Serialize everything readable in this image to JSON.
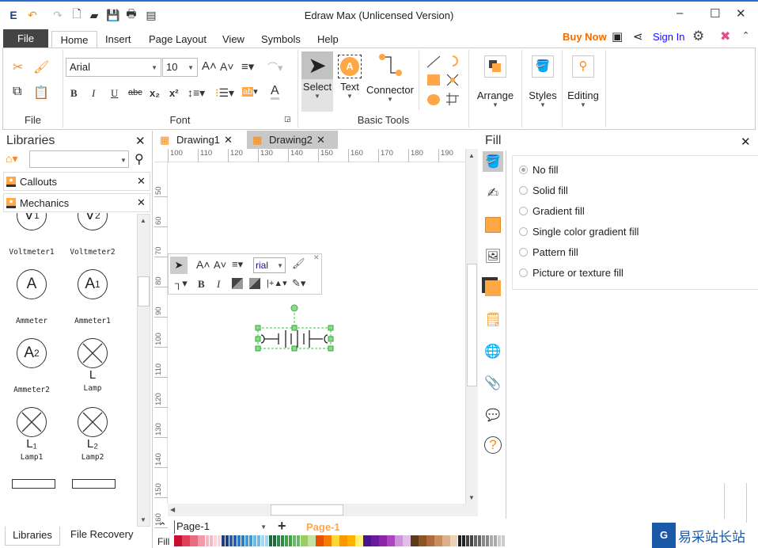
{
  "app": {
    "title": "Edraw Max (Unlicensed Version)"
  },
  "menu": {
    "file": "File",
    "tabs": [
      "Home",
      "Insert",
      "Page Layout",
      "View",
      "Symbols",
      "Help"
    ],
    "buy_now": "Buy Now",
    "sign_in": "Sign In"
  },
  "ribbon": {
    "font_name": "Arial",
    "font_size": "10",
    "groups": {
      "file": "File",
      "font": "Font",
      "basic_tools": "Basic Tools"
    },
    "select": "Select",
    "text": "Text",
    "connector": "Connector",
    "arrange": "Arrange",
    "styles": "Styles",
    "editing": "Editing"
  },
  "libraries": {
    "title": "Libraries",
    "search_value": "",
    "sections": [
      "Callouts",
      "Mechanics"
    ],
    "shapes": [
      {
        "glyph": "V",
        "sub": "1",
        "label": "Voltmeter1"
      },
      {
        "glyph": "V",
        "sub": "2",
        "label": "Voltmeter2"
      },
      {
        "glyph": "A",
        "sub": "",
        "label": "Ammeter"
      },
      {
        "glyph": "A",
        "sub": "1",
        "label": "Ammeter1"
      },
      {
        "glyph": "A",
        "sub": "2",
        "label": "Ammeter2"
      },
      {
        "glyph": "⊗",
        "sub": "L",
        "label": "Lamp"
      },
      {
        "glyph": "⊗",
        "sub": "L₁",
        "label": "Lamp1"
      },
      {
        "glyph": "⊗",
        "sub": "L₂",
        "label": "Lamp2"
      }
    ],
    "bottom_tabs": [
      "Libraries",
      "File Recovery"
    ]
  },
  "documents": {
    "tabs": [
      "Drawing1",
      "Drawing2"
    ],
    "active": "Drawing2"
  },
  "ruler": {
    "h": [
      "100",
      "110",
      "120",
      "130",
      "140",
      "150",
      "160",
      "170",
      "180",
      "190"
    ],
    "v": [
      "50",
      "60",
      "70",
      "80",
      "90",
      "100",
      "110",
      "120",
      "130",
      "140",
      "150",
      "160"
    ]
  },
  "mini_toolbar": {
    "font": "rial"
  },
  "pages": {
    "current": "Page-1",
    "active_tab": "Page-1"
  },
  "palette": {
    "label": "Fill",
    "groups": [
      [
        "#c8102e",
        "#e0405a",
        "#e86b80",
        "#f09aaa",
        "#f4b8c4",
        "#f8d6dc"
      ],
      [
        "#1f3c88",
        "#2a5caa",
        "#2f79c9",
        "#3f9ad8",
        "#6cb8e6",
        "#a5d5f1"
      ],
      [
        "#1a6b3a",
        "#2d8a4a",
        "#43a047",
        "#66bb6a",
        "#9ccc65",
        "#c5e1a5"
      ],
      [
        "#e65100",
        "#f57c00",
        "#ff9800",
        "#ffb300",
        "#fdd835",
        "#fff176"
      ],
      [
        "#4a148c",
        "#6a1b9a",
        "#8e24aa",
        "#ab47bc",
        "#ce93d8",
        "#e1bee7"
      ],
      [
        "#5d3a1a",
        "#8d5524",
        "#b06a3b",
        "#c98e5d",
        "#dbb08a",
        "#ecd3b8"
      ],
      [
        "#222222",
        "#444444",
        "#666666",
        "#888888",
        "#aaaaaa",
        "#cccccc"
      ]
    ]
  },
  "fill_panel": {
    "title": "Fill",
    "options": [
      "No fill",
      "Solid fill",
      "Gradient fill",
      "Single color gradient fill",
      "Pattern fill",
      "Picture or texture fill"
    ],
    "selected": "No fill"
  },
  "colors": {
    "accent": "#ffa646",
    "buy_now": "#f26b00",
    "sign_in": "#1a0dff",
    "file_tab": "#444444"
  }
}
